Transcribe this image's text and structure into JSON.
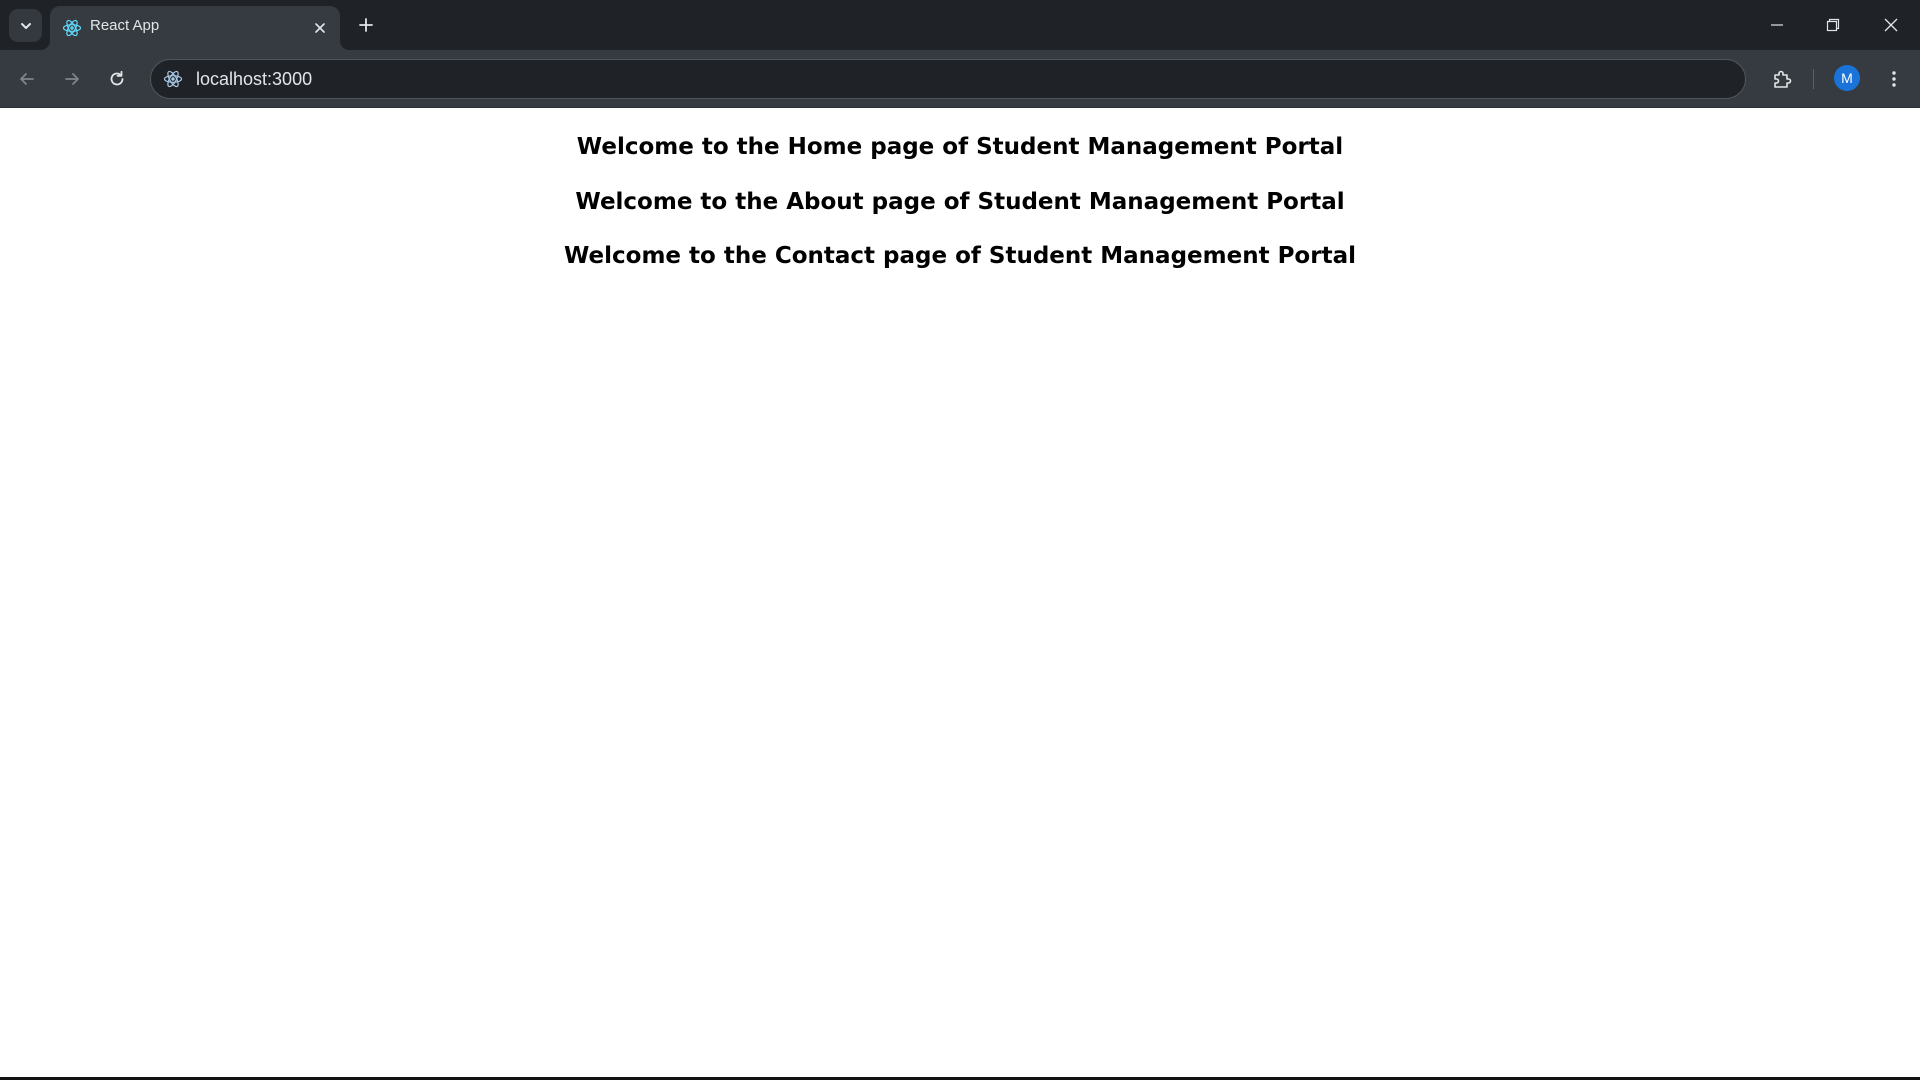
{
  "browser": {
    "tab": {
      "title": "React App",
      "favicon": "react-icon"
    },
    "url": "localhost:3000",
    "profile_initial": "M",
    "colors": {
      "tabstrip": "#1f2327",
      "toolbar": "#353b40",
      "avatar": "#1a73d9",
      "react_accent": "#61dafb"
    }
  },
  "page": {
    "headings": [
      "Welcome to the Home page of Student Management Portal",
      "Welcome to the About page of Student Management Portal",
      "Welcome to the Contact page of Student Management Portal"
    ]
  }
}
